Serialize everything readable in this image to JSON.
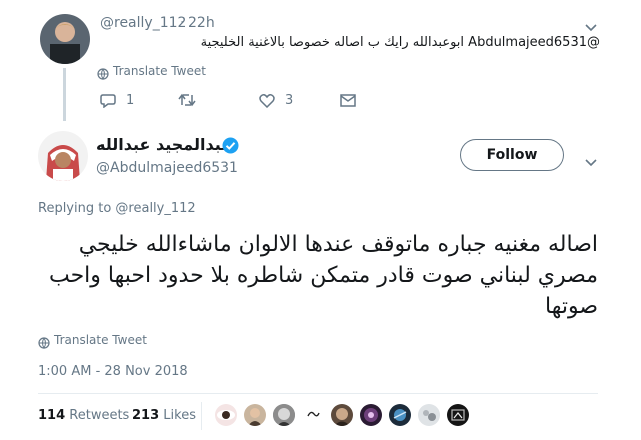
{
  "parent_tweet": {
    "handle": "@really_112",
    "time": "22h",
    "text": "@Abdulmajeed6531 ابوعبدالله رايك ب اصاله خصوصا بالاغنية الخليجية",
    "translate_label": "Translate Tweet",
    "reply_count": "1",
    "like_count": "3"
  },
  "main_tweet": {
    "display_name": "عبدالمجيد عبدالله",
    "handle": "@Abdulmajeed6531",
    "follow_label": "Follow",
    "replying_to": "Replying to @really_112",
    "text": "اصاله مغنيه جباره ماتوقف عندها الالوان ماشاءالله خليجي مصري لبناني صوت قادر متمكن شاطره بلا حدود احبها واحب صوتها",
    "translate_label": "Translate Tweet",
    "timestamp": "1:00 AM - 28 Nov 2018",
    "retweet_count": "114",
    "retweet_label": "Retweets",
    "like_count": "213",
    "like_label": "Likes"
  },
  "colors": {
    "accent": "#1da1f2",
    "muted": "#657786",
    "text": "#14171a",
    "border": "#e6ecf0"
  }
}
